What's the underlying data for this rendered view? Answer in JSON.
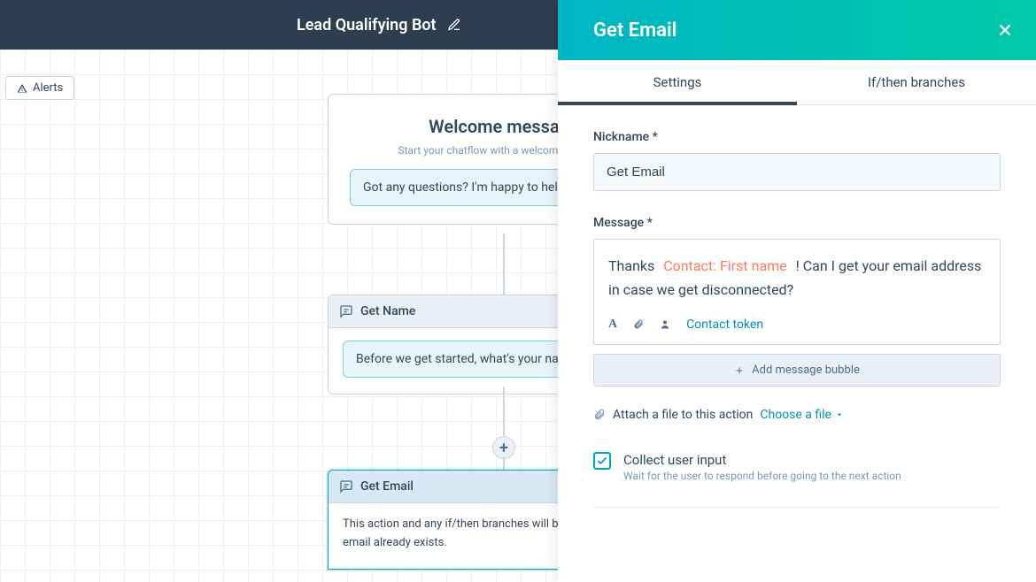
{
  "header": {
    "title": "Lead Qualifying Bot"
  },
  "alerts_label": "Alerts",
  "cards": {
    "welcome": {
      "title": "Welcome message",
      "subtitle": "Start your chatflow with a welcome message",
      "bubble": "Got any questions? I'm happy to help."
    },
    "getname": {
      "title": "Get Name",
      "bubble": "Before we get started, what's your name?"
    },
    "getemail": {
      "title": "Get Email",
      "body": "This action and any if/then branches will be skipped if the email already exists."
    }
  },
  "drawer": {
    "title": "Get Email",
    "tabs": {
      "settings": "Settings",
      "branches": "If/then branches"
    },
    "nickname_label": "Nickname *",
    "nickname_value": "Get Email",
    "message_label": "Message *",
    "message_parts": {
      "pre": "Thanks",
      "token": "Contact: First name",
      "post": "! Can I get your email address in case we get disconnected?"
    },
    "contact_token_link": "Contact token",
    "add_bubble": "Add message bubble",
    "attach_label": "Attach a file to this action",
    "choose_file": "Choose a file",
    "collect": {
      "title": "Collect user input",
      "subtitle": "Wait for the user to respond before going to the next action"
    }
  }
}
